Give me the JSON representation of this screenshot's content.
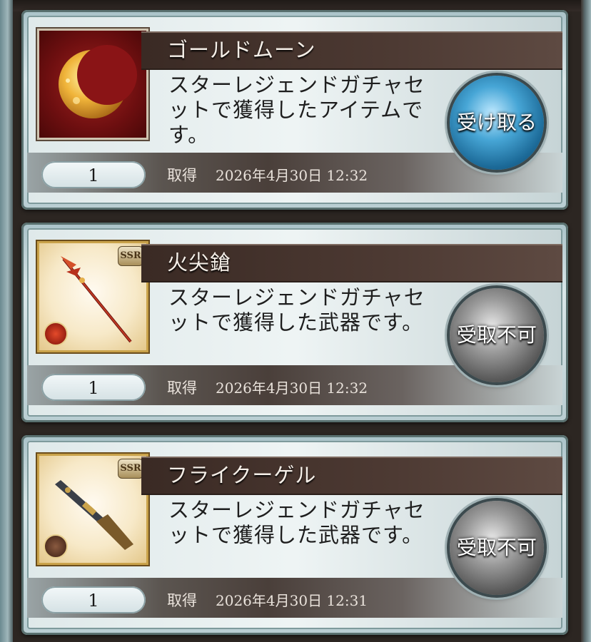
{
  "items": [
    {
      "name": "ゴールドムーン",
      "description": "スターレジェンドガチャセットで獲得したアイテムです。",
      "quantity": "1",
      "date_label": "取得",
      "date_value": "2026年4月30日 12:32",
      "button_label": "受け取る",
      "button_state": "available",
      "icon": "gold-moon-icon"
    },
    {
      "name": "火尖鎗",
      "description": "スターレジェンドガチャセットで獲得した武器です。",
      "quantity": "1",
      "date_label": "取得",
      "date_value": "2026年4月30日 12:32",
      "button_label": "受取不可",
      "button_state": "disabled",
      "rarity": "SSR",
      "icon": "spear-icon"
    },
    {
      "name": "フライクーゲル",
      "description": "スターレジェンドガチャセットで獲得した武器です。",
      "quantity": "1",
      "date_label": "取得",
      "date_value": "2026年4月30日 12:31",
      "button_label": "受取不可",
      "button_state": "disabled",
      "rarity": "SSR",
      "icon": "gun-icon"
    }
  ],
  "colors": {
    "available_button": "#47a6d6",
    "disabled_button": "#9a9a9a",
    "title_bar": "#3a2a24"
  }
}
